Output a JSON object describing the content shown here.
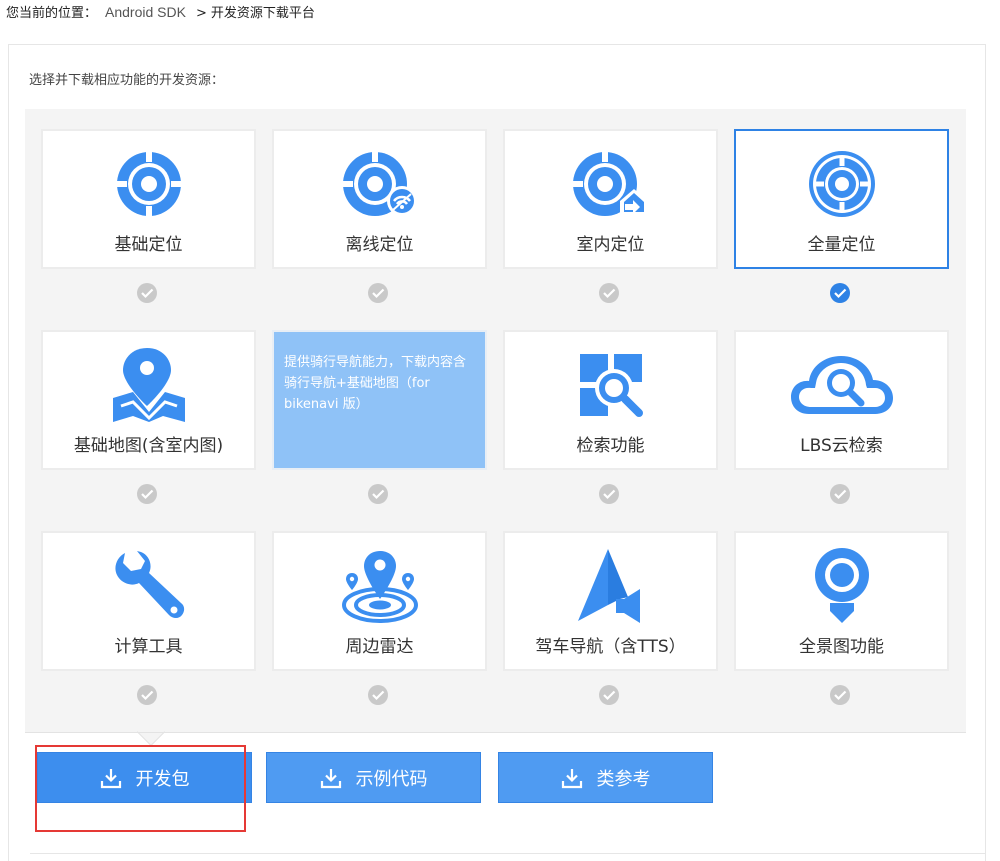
{
  "breadcrumb": {
    "prefix": "您当前的位置：",
    "sdk": "Android SDK",
    "separator": ">",
    "current": "开发资源下载平台"
  },
  "panel": {
    "title": "选择并下载相应功能的开发资源："
  },
  "tiles": [
    {
      "label": "基础定位",
      "icon": "basic-location-icon",
      "checked": false
    },
    {
      "label": "离线定位",
      "icon": "offline-location-icon",
      "checked": false
    },
    {
      "label": "室内定位",
      "icon": "indoor-location-icon",
      "checked": false
    },
    {
      "label": "全量定位",
      "icon": "full-location-icon",
      "checked": true
    },
    {
      "label": "基础地图(含室内图)",
      "icon": "basic-map-icon",
      "checked": false
    },
    {
      "label": "",
      "description": "提供骑行导航能力，下载内容含骑行导航+基础地图（for bikenavi 版）",
      "icon": "",
      "checked": false
    },
    {
      "label": "检索功能",
      "icon": "search-function-icon",
      "checked": false
    },
    {
      "label": "LBS云检索",
      "icon": "lbs-cloud-search-icon",
      "checked": false
    },
    {
      "label": "计算工具",
      "icon": "wrench-icon",
      "checked": false
    },
    {
      "label": "周边雷达",
      "icon": "radar-icon",
      "checked": false
    },
    {
      "label": "驾车导航（含TTS）",
      "icon": "car-navigation-icon",
      "checked": false
    },
    {
      "label": "全景图功能",
      "icon": "panorama-icon",
      "checked": false
    }
  ],
  "buttons": [
    {
      "label": "开发包",
      "icon": "download-icon"
    },
    {
      "label": "示例代码",
      "icon": "download-icon"
    },
    {
      "label": "类参考",
      "icon": "download-icon"
    }
  ],
  "colors": {
    "accent": "#2e82e5",
    "button": "#3d8eee",
    "hover_tile": "#8fc2f7",
    "highlight": "#e53935"
  }
}
